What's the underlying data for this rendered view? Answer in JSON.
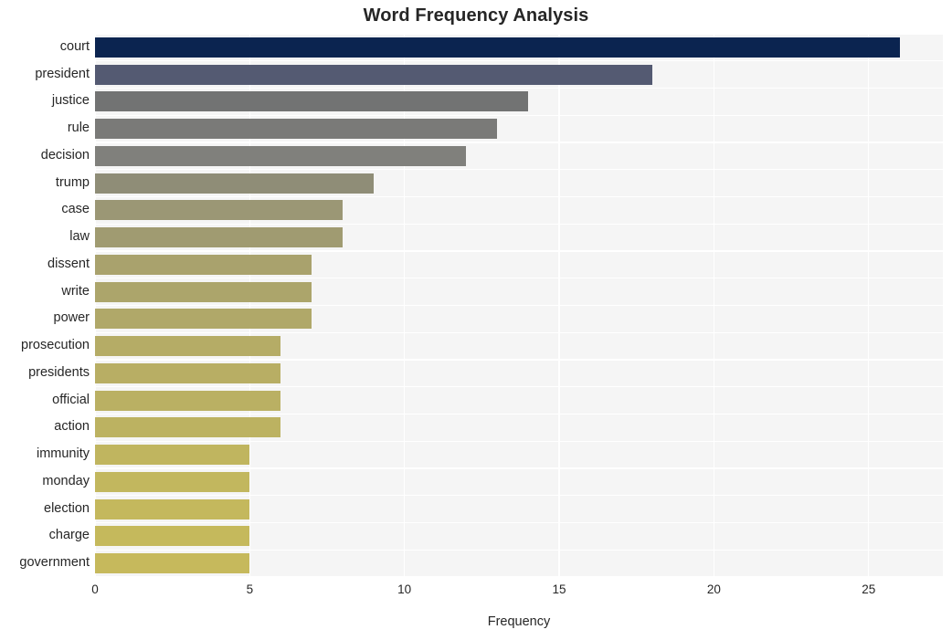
{
  "chart_data": {
    "type": "bar",
    "orientation": "horizontal",
    "title": "Word Frequency Analysis",
    "xlabel": "Frequency",
    "ylabel": "",
    "categories": [
      "court",
      "president",
      "justice",
      "rule",
      "decision",
      "trump",
      "case",
      "law",
      "dissent",
      "write",
      "power",
      "prosecution",
      "presidents",
      "official",
      "action",
      "immunity",
      "monday",
      "election",
      "charge",
      "government"
    ],
    "values": [
      26,
      18,
      14,
      13,
      12,
      9,
      8,
      8,
      7,
      7,
      7,
      6,
      6,
      6,
      6,
      5,
      5,
      5,
      5,
      5
    ],
    "bar_colors": [
      "#0b2450",
      "#545a72",
      "#727373",
      "#7a7a78",
      "#80807c",
      "#8f8d77",
      "#9b9775",
      "#a09b71",
      "#a9a26d",
      "#aca56b",
      "#b0a869",
      "#b5ac66",
      "#b8ae64",
      "#bab063",
      "#bcb261",
      "#c0b55f",
      "#c2b75e",
      "#c4b85d",
      "#c5b95c",
      "#c6b95c"
    ],
    "xticks": [
      0,
      5,
      10,
      15,
      20,
      25
    ],
    "xlim": [
      0,
      27.4
    ],
    "ylim_count": 20,
    "grid": true,
    "grid_color": "#ffffff",
    "plot_background": "#f5f5f5",
    "figure_background": "#ffffff",
    "legend": null,
    "annotations": []
  }
}
